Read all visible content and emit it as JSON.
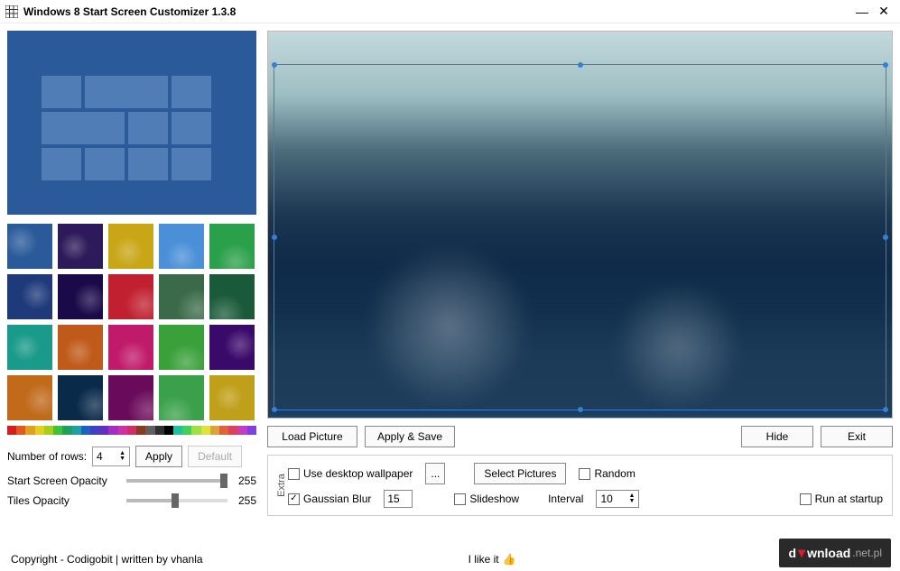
{
  "titlebar": {
    "title": "Windows 8 Start Screen Customizer 1.3.8"
  },
  "left": {
    "rows_label": "Number of rows:",
    "rows_value": "4",
    "apply": "Apply",
    "default": "Default",
    "opacity_label": "Start Screen Opacity",
    "opacity_value": "255",
    "tiles_label": "Tiles Opacity",
    "tiles_value": "255"
  },
  "thumbs_bg": [
    "#2a5a9a",
    "#2d1a5a",
    "#c9a615",
    "#4a8fd8",
    "#2aa04a",
    "#1e3a7a",
    "#1a0a4a",
    "#c02030",
    "#3a6a4a",
    "#1a5a3a",
    "#1a9a8a",
    "#c05a1a",
    "#c01a6a",
    "#3aa03a",
    "#3a0a6a",
    "#c06a1a",
    "#0a2a4a",
    "#6a0a5a",
    "#3aa04a",
    "#c0a01a"
  ],
  "colorbar": [
    "#d02020",
    "#e05a20",
    "#e0a020",
    "#e0d020",
    "#a0d020",
    "#40c040",
    "#20a060",
    "#20a0a0",
    "#2060c0",
    "#4040c0",
    "#6030c0",
    "#a030c0",
    "#d030a0",
    "#d03060",
    "#804020",
    "#606060",
    "#303030",
    "#000000",
    "#20c0a0",
    "#40d060",
    "#a0e040",
    "#e0e040",
    "#e0a040",
    "#e06040",
    "#e04060",
    "#c040c0",
    "#8040e0"
  ],
  "buttons": {
    "load": "Load Picture",
    "applysave": "Apply & Save",
    "hide": "Hide",
    "exit": "Exit"
  },
  "extra": {
    "group": "Extra",
    "desktop_wp": "Use desktop wallpaper",
    "browse": "...",
    "select_pics": "Select Pictures",
    "random": "Random",
    "gaussian": "Gaussian Blur",
    "gaussian_val": "15",
    "slideshow": "Slideshow",
    "interval_label": "Interval",
    "interval_val": "10",
    "startup": "Run at startup",
    "gaussian_checked": true
  },
  "footer": {
    "copyright": "Copyright - Codigobit | written by vhanla",
    "like": "I like it"
  },
  "badge": {
    "pre": "d",
    "post": "wnload",
    "suffix": ".net.pl"
  }
}
